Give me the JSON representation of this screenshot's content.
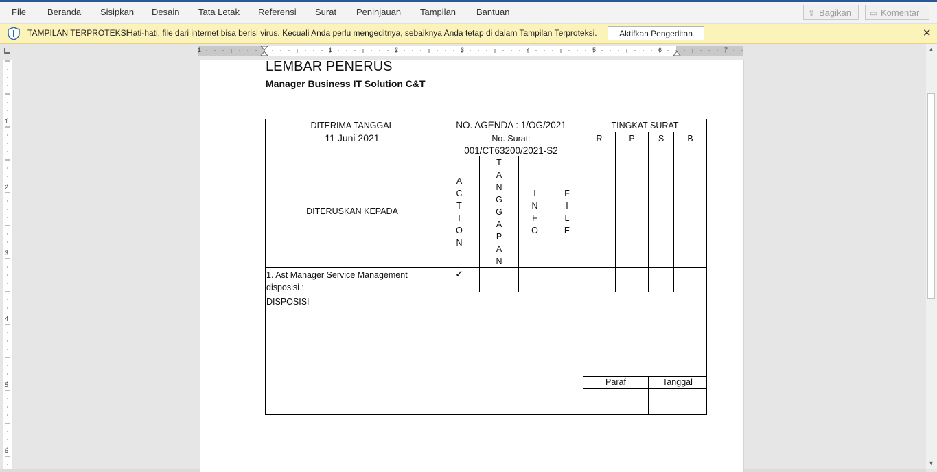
{
  "menu": [
    "File",
    "Beranda",
    "Sisipkan",
    "Desain",
    "Tata Letak",
    "Referensi",
    "Surat",
    "Peninjauan",
    "Tampilan",
    "Bantuan"
  ],
  "toolbar": {
    "share_label": "Bagikan",
    "comment_label": "Komentar"
  },
  "protected_view": {
    "title": "TAMPILAN TERPROTEKSI",
    "message": "Hati-hati, file dari internet bisa berisi virus. Kecuali Anda perlu mengeditnya, sebaiknya Anda tetap di dalam Tampilan Terproteksi.",
    "button": "Aktifkan Pengeditan",
    "close": "✕"
  },
  "ruler": {
    "h_labels": [
      "1",
      "1",
      "2",
      "3",
      "4",
      "5",
      "6",
      "7"
    ],
    "v_labels": [
      "1",
      "2",
      "3",
      "4",
      "5",
      "6"
    ]
  },
  "document": {
    "title": "LEMBAR PENERUS",
    "subtitle": "Manager Business IT Solution C&T",
    "table": {
      "received_date_header": "DITERIMA TANGGAL",
      "received_date": "11 Juni 2021",
      "agenda": "NO. AGENDA : 1/OG/2021",
      "letter_no_label": "No. Surat:",
      "letter_no": "001/CT63200/2021-S2",
      "level_header": "TINGKAT SURAT",
      "levels": [
        "R",
        "P",
        "S",
        "B"
      ],
      "forwarded_to": "DITERUSKAN KEPADA",
      "columns": {
        "action": [
          "A",
          "C",
          "T",
          "I",
          "O",
          "N"
        ],
        "tanggapan": [
          "T",
          "A",
          "N",
          "G",
          "G",
          "A",
          "P",
          "A",
          "N"
        ],
        "info": [
          "I",
          "N",
          "F",
          "O"
        ],
        "file": [
          "F",
          "I",
          "L",
          "E"
        ]
      },
      "recipient_line1": "1. Ast Manager Service Management",
      "recipient_line2": "disposisi :",
      "checkmark": "✓",
      "disposition": "DISPOSISI",
      "paraf": "Paraf",
      "tanggal": "Tanggal"
    }
  },
  "colors": {
    "accent": "#2b579a",
    "warning_bar": "#fcf3ba",
    "info_icon": "#2b6cb0"
  }
}
